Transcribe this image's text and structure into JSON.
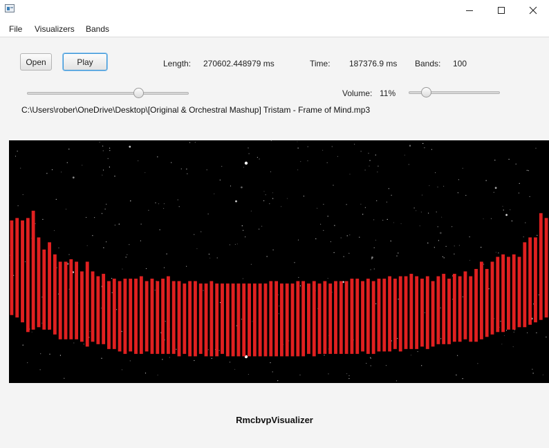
{
  "menu": [
    "File",
    "Visualizers",
    "Bands"
  ],
  "controls": {
    "open_label": "Open",
    "play_label": "Play",
    "length_label": "Length:",
    "length_value": "270602.448979 ms",
    "time_label": "Time:",
    "time_value": "187376.9 ms",
    "bands_label": "Bands:",
    "bands_value": "100",
    "volume_label": "Volume:",
    "volume_value": "11%",
    "seek_fraction": 0.69,
    "volume_fraction": 0.11,
    "file_path": "C:\\Users\\rober\\OneDrive\\Desktop\\[Original & Orchestral Mashup] Tristam - Frame of Mind.mp3"
  },
  "visualizer": {
    "background": "#000000",
    "bar_color": "#e02020",
    "bars": [
      [
        0.33,
        0.72
      ],
      [
        0.32,
        0.73
      ],
      [
        0.33,
        0.75
      ],
      [
        0.32,
        0.79
      ],
      [
        0.29,
        0.78
      ],
      [
        0.4,
        0.77
      ],
      [
        0.45,
        0.78
      ],
      [
        0.42,
        0.78
      ],
      [
        0.47,
        0.8
      ],
      [
        0.5,
        0.82
      ],
      [
        0.5,
        0.82
      ],
      [
        0.49,
        0.82
      ],
      [
        0.5,
        0.82
      ],
      [
        0.54,
        0.83
      ],
      [
        0.5,
        0.85
      ],
      [
        0.54,
        0.83
      ],
      [
        0.56,
        0.84
      ],
      [
        0.55,
        0.84
      ],
      [
        0.58,
        0.86
      ],
      [
        0.57,
        0.86
      ],
      [
        0.58,
        0.87
      ],
      [
        0.57,
        0.88
      ],
      [
        0.57,
        0.87
      ],
      [
        0.57,
        0.88
      ],
      [
        0.56,
        0.88
      ],
      [
        0.58,
        0.87
      ],
      [
        0.57,
        0.88
      ],
      [
        0.58,
        0.88
      ],
      [
        0.57,
        0.88
      ],
      [
        0.56,
        0.88
      ],
      [
        0.58,
        0.88
      ],
      [
        0.58,
        0.89
      ],
      [
        0.59,
        0.88
      ],
      [
        0.58,
        0.89
      ],
      [
        0.58,
        0.89
      ],
      [
        0.59,
        0.88
      ],
      [
        0.59,
        0.89
      ],
      [
        0.58,
        0.89
      ],
      [
        0.59,
        0.89
      ],
      [
        0.59,
        0.88
      ],
      [
        0.59,
        0.89
      ],
      [
        0.59,
        0.89
      ],
      [
        0.59,
        0.89
      ],
      [
        0.59,
        0.89
      ],
      [
        0.59,
        0.89
      ],
      [
        0.59,
        0.89
      ],
      [
        0.59,
        0.89
      ],
      [
        0.59,
        0.89
      ],
      [
        0.58,
        0.89
      ],
      [
        0.58,
        0.89
      ],
      [
        0.59,
        0.89
      ],
      [
        0.59,
        0.89
      ],
      [
        0.59,
        0.89
      ],
      [
        0.58,
        0.89
      ],
      [
        0.58,
        0.89
      ],
      [
        0.59,
        0.88
      ],
      [
        0.58,
        0.89
      ],
      [
        0.59,
        0.88
      ],
      [
        0.58,
        0.88
      ],
      [
        0.59,
        0.88
      ],
      [
        0.58,
        0.88
      ],
      [
        0.58,
        0.88
      ],
      [
        0.58,
        0.88
      ],
      [
        0.57,
        0.88
      ],
      [
        0.57,
        0.88
      ],
      [
        0.58,
        0.87
      ],
      [
        0.57,
        0.88
      ],
      [
        0.58,
        0.88
      ],
      [
        0.57,
        0.87
      ],
      [
        0.57,
        0.87
      ],
      [
        0.56,
        0.87
      ],
      [
        0.57,
        0.86
      ],
      [
        0.56,
        0.87
      ],
      [
        0.56,
        0.86
      ],
      [
        0.55,
        0.86
      ],
      [
        0.56,
        0.86
      ],
      [
        0.57,
        0.85
      ],
      [
        0.56,
        0.86
      ],
      [
        0.58,
        0.85
      ],
      [
        0.56,
        0.84
      ],
      [
        0.55,
        0.84
      ],
      [
        0.57,
        0.84
      ],
      [
        0.55,
        0.83
      ],
      [
        0.56,
        0.83
      ],
      [
        0.54,
        0.82
      ],
      [
        0.56,
        0.83
      ],
      [
        0.53,
        0.83
      ],
      [
        0.5,
        0.82
      ],
      [
        0.53,
        0.81
      ],
      [
        0.5,
        0.8
      ],
      [
        0.48,
        0.79
      ],
      [
        0.47,
        0.79
      ],
      [
        0.48,
        0.78
      ],
      [
        0.47,
        0.78
      ],
      [
        0.48,
        0.77
      ],
      [
        0.42,
        0.77
      ],
      [
        0.4,
        0.76
      ],
      [
        0.4,
        0.75
      ],
      [
        0.3,
        0.74
      ],
      [
        0.32,
        0.73
      ]
    ]
  },
  "footer": {
    "title": "RmcbvpVisualizer"
  }
}
